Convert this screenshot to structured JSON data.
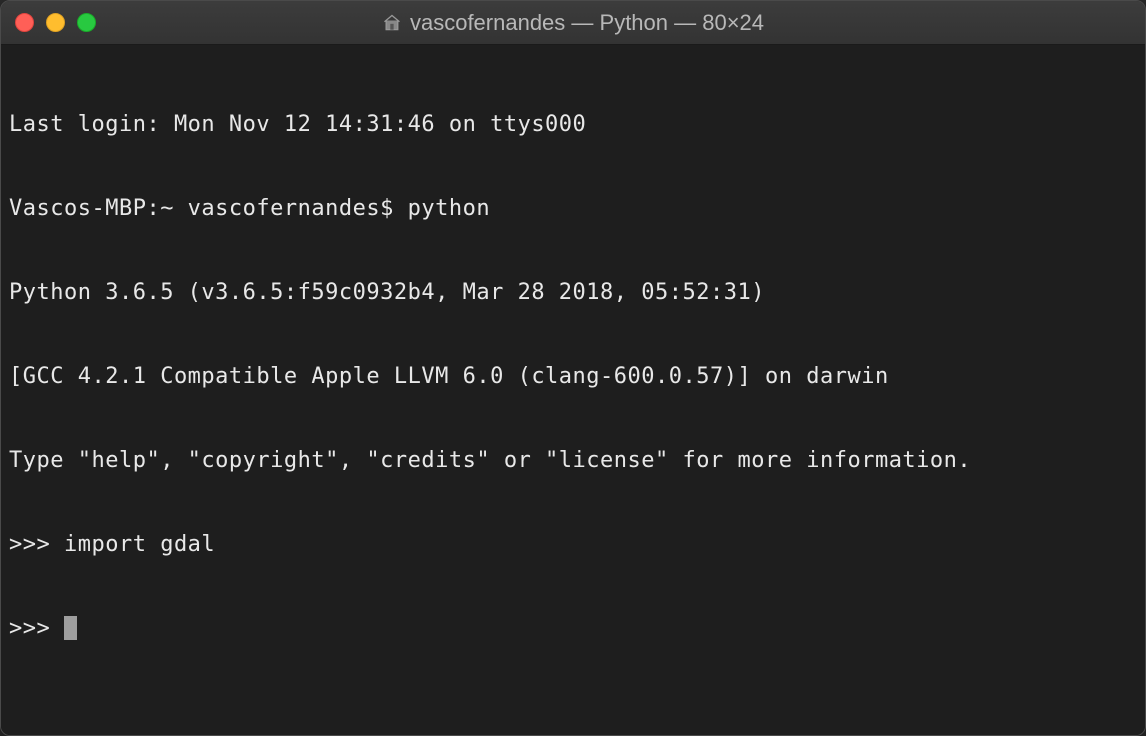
{
  "window": {
    "title": "vascofernandes — Python — 80×24",
    "home_icon": "home-icon"
  },
  "terminal": {
    "lines": [
      "Last login: Mon Nov 12 14:31:46 on ttys000",
      "Vascos-MBP:~ vascofernandes$ python",
      "Python 3.6.5 (v3.6.5:f59c0932b4, Mar 28 2018, 05:52:31)",
      "[GCC 4.2.1 Compatible Apple LLVM 6.0 (clang-600.0.57)] on darwin",
      "Type \"help\", \"copyright\", \"credits\" or \"license\" for more information.",
      ">>> import gdal",
      ">>> "
    ]
  },
  "colors": {
    "background": "#1e1e1e",
    "text": "#e8e8e8",
    "titlebar": "#363636",
    "close": "#ff5f57",
    "minimize": "#ffbd2e",
    "maximize": "#28c940"
  }
}
